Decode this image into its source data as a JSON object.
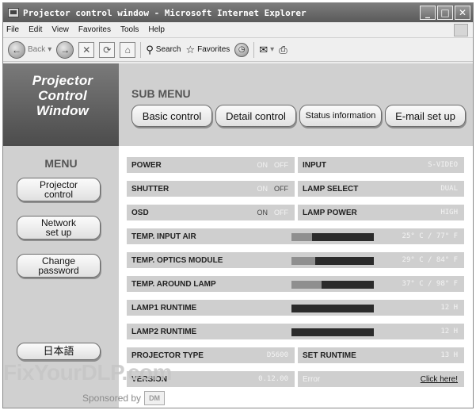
{
  "window": {
    "title": "Projector control window - Microsoft Internet Explorer",
    "controls": [
      "_",
      "□",
      "✕"
    ]
  },
  "menubar": {
    "items": [
      "File",
      "Edit",
      "View",
      "Favorites",
      "Tools",
      "Help"
    ]
  },
  "toolbar": {
    "back_label": "Back",
    "search_label": "Search",
    "favorites_label": "Favorites"
  },
  "banner": {
    "title_lines": [
      "Projector",
      "Control",
      "Window"
    ]
  },
  "submenu": {
    "heading": "SUB MENU",
    "buttons": [
      "Basic control",
      "Detail control",
      "Status information",
      "E-mail set up"
    ]
  },
  "sidebar": {
    "heading": "MENU",
    "buttons": [
      [
        "Projector",
        "control"
      ],
      [
        "Network",
        "set up"
      ],
      [
        "Change",
        "password"
      ]
    ],
    "language_button": "日本語"
  },
  "status": {
    "power": {
      "label": "POWER",
      "on": "ON",
      "off": "OFF"
    },
    "shutter": {
      "label": "SHUTTER",
      "on": "ON",
      "off": "OFF"
    },
    "osd": {
      "label": "OSD",
      "on": "ON",
      "off": "OFF"
    },
    "input": {
      "label": "INPUT",
      "value": "S-VIDEO"
    },
    "lamp_select": {
      "label": "LAMP SELECT",
      "value": "DUAL"
    },
    "lamp_power": {
      "label": "LAMP POWER",
      "value": "HIGH"
    },
    "temp_input_air": {
      "label": "TEMP. INPUT AIR",
      "value": "25° C / 77° F",
      "level": 0.25
    },
    "temp_optics": {
      "label": "TEMP. OPTICS MODULE",
      "value": "29° C / 84° F",
      "level": 0.29
    },
    "temp_lamp": {
      "label": "TEMP. AROUND LAMP",
      "value": "37° C / 98° F",
      "level": 0.37
    },
    "lamp1_runtime": {
      "label": "LAMP1 RUNTIME",
      "value": "12 H",
      "level": 0.0
    },
    "lamp2_runtime": {
      "label": "LAMP2 RUNTIME",
      "value": "12 H",
      "level": 0.0
    },
    "projector_type": {
      "label": "PROJECTOR TYPE",
      "value": "D5600"
    },
    "set_runtime": {
      "label": "SET RUNTIME",
      "value": "13 H"
    },
    "version": {
      "label": "VERSION",
      "value": "0.12.00"
    },
    "error": {
      "label": "Error",
      "link": "Click here!"
    }
  },
  "overlay": {
    "watermark": "FixYourDLP.com",
    "sponsor_text": "Sponsored by",
    "sponsor_logo": "DM"
  },
  "colors": {
    "banner_dark": "#4c4c4c",
    "panel_gray": "#d0d0d0",
    "cell_gray": "#cfcfcf",
    "bar_dark": "#2b2b2b"
  }
}
